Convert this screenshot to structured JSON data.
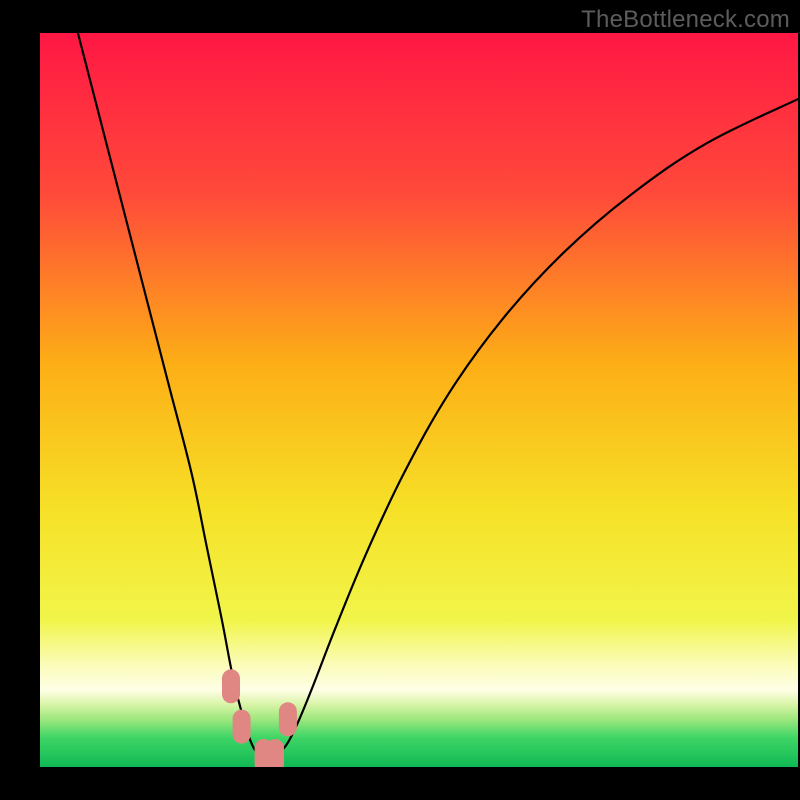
{
  "watermark": "TheBottleneck.com",
  "chart_data": {
    "type": "line",
    "title": "",
    "xlabel": "",
    "ylabel": "",
    "xlim": [
      0,
      100
    ],
    "ylim": [
      0,
      100
    ],
    "grid": false,
    "legend": false,
    "series": [
      {
        "name": "bottleneck-curve",
        "x": [
          5,
          8,
          11,
          14,
          17,
          20,
          22,
          24,
          25.5,
          27,
          28,
          29,
          30,
          31,
          32.5,
          34,
          36,
          39,
          43,
          48,
          54,
          61,
          69,
          78,
          88,
          100
        ],
        "y": [
          100,
          88,
          76,
          64,
          52,
          40,
          30,
          20,
          12,
          6,
          3,
          1.5,
          1,
          1.5,
          3,
          6,
          11,
          19,
          29,
          40,
          51,
          61,
          70,
          78,
          85,
          91
        ]
      }
    ],
    "markers": {
      "name": "rounded-highlight",
      "x_positions_pct": [
        25.2,
        26.6,
        29.5,
        31.0,
        32.7
      ],
      "y_positions_pct": [
        11,
        5.5,
        1.5,
        1.5,
        6.5
      ],
      "color": "#e08784"
    },
    "background_gradient": {
      "stops": [
        {
          "pct": 0,
          "color": "#ff1744"
        },
        {
          "pct": 22,
          "color": "#ff4a3a"
        },
        {
          "pct": 45,
          "color": "#fdae16"
        },
        {
          "pct": 65,
          "color": "#f6e127"
        },
        {
          "pct": 80,
          "color": "#f1f54a"
        },
        {
          "pct": 86,
          "color": "#fbfcb8"
        },
        {
          "pct": 89.5,
          "color": "#fefee6"
        },
        {
          "pct": 91.5,
          "color": "#d8f4a6"
        },
        {
          "pct": 93.5,
          "color": "#9de77e"
        },
        {
          "pct": 96,
          "color": "#3fd566"
        },
        {
          "pct": 100,
          "color": "#10b954"
        }
      ]
    }
  }
}
